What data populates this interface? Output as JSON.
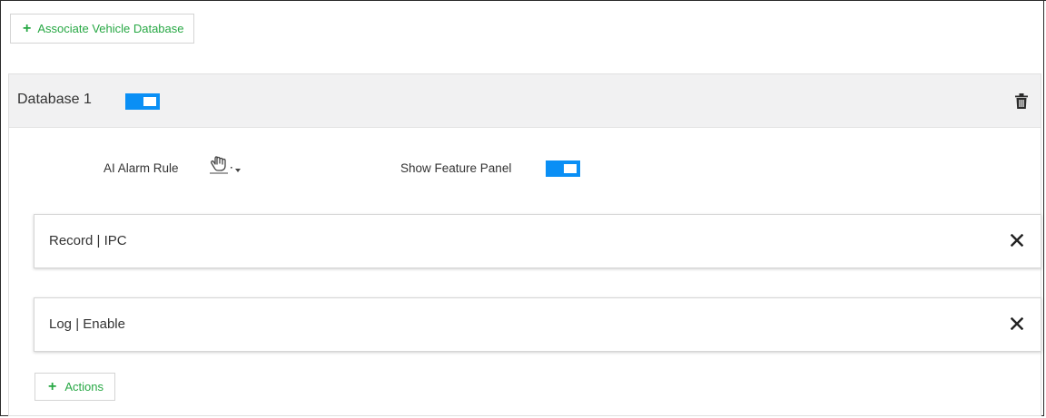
{
  "toolbar": {
    "associate_label": "Associate Vehicle Database",
    "plus_icon": "plus-icon"
  },
  "database": {
    "title": "Database 1",
    "enabled": true,
    "delete_icon": "trash-icon",
    "ai_alarm_rule_label": "AI Alarm Rule",
    "ai_alarm_rule_icon": "hand-pointer-dropdown-icon",
    "show_feature_panel_label": "Show Feature Panel",
    "show_feature_panel_enabled": true
  },
  "actions": [
    {
      "text": "Record | IPC",
      "remove_icon": "close-icon"
    },
    {
      "text": "Log | Enable",
      "remove_icon": "close-icon"
    }
  ],
  "add_actions_label": "Actions",
  "colors": {
    "accent_green": "#27a844",
    "toggle_blue": "#0a8ff5",
    "header_gray": "#f1f1f2"
  }
}
